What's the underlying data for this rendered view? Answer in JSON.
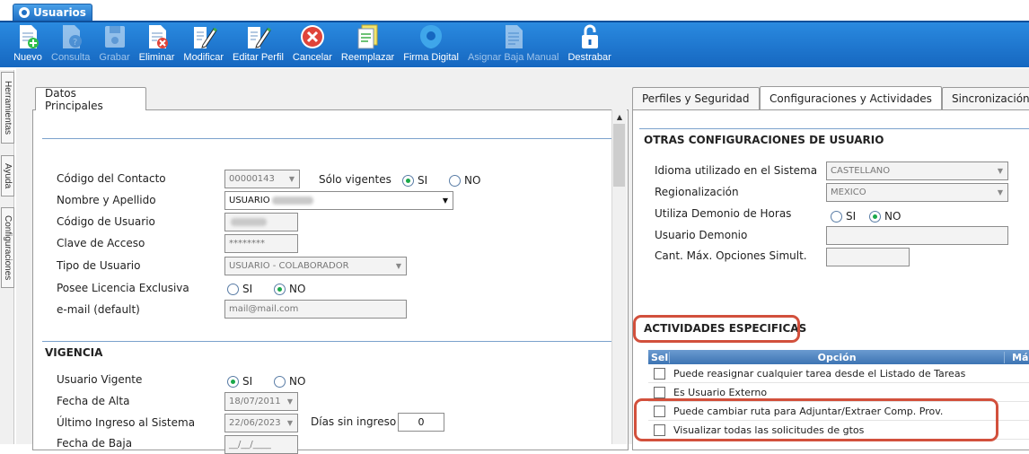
{
  "window_tab": {
    "title": "Usuarios"
  },
  "toolbar": [
    {
      "label": "Nuevo",
      "icon": "new-doc-icon",
      "enabled": true
    },
    {
      "label": "Consulta",
      "icon": "query-icon",
      "enabled": false
    },
    {
      "label": "Grabar",
      "icon": "save-icon",
      "enabled": false
    },
    {
      "label": "Eliminar",
      "icon": "delete-icon",
      "enabled": true
    },
    {
      "label": "Modificar",
      "icon": "edit-icon",
      "enabled": true
    },
    {
      "label": "Editar Perfil",
      "icon": "edit-profile-icon",
      "enabled": true
    },
    {
      "label": "Cancelar",
      "icon": "cancel-icon",
      "enabled": true
    },
    {
      "label": "Reemplazar",
      "icon": "replace-icon",
      "enabled": true
    },
    {
      "label": "Firma Digital",
      "icon": "digital-signature-icon",
      "enabled": true
    },
    {
      "label": "Asignar Baja Manual",
      "icon": "manual-removal-icon",
      "enabled": false
    },
    {
      "label": "Destrabar",
      "icon": "unlock-icon",
      "enabled": true
    }
  ],
  "side_tabs": [
    "Herramientas",
    "Ayuda",
    "Configuraciones"
  ],
  "left": {
    "tab": "Datos Principales",
    "codigo_contacto": {
      "label": "Código del Contacto",
      "value": "00000143"
    },
    "solo_vigentes": {
      "label": "Sólo vigentes",
      "si": "SI",
      "no": "NO"
    },
    "nombre": {
      "label": "Nombre y Apellido",
      "value": "USUARIO"
    },
    "codigo_usuario": {
      "label": "Código de Usuario"
    },
    "clave": {
      "label": "Clave de Acceso",
      "value": "********"
    },
    "tipo_usuario": {
      "label": "Tipo de Usuario",
      "value": "USUARIO - COLABORADOR"
    },
    "licencia": {
      "label": "Posee Licencia Exclusiva",
      "si": "SI",
      "no": "NO"
    },
    "email": {
      "label": "e-mail (default)",
      "value": "mail@mail.com"
    },
    "vigencia_title": "VIGENCIA",
    "usuario_vigente": {
      "label": "Usuario Vigente",
      "si": "SI",
      "no": "NO"
    },
    "fecha_alta": {
      "label": "Fecha de Alta",
      "value": "18/07/2011"
    },
    "ultimo_ingreso": {
      "label": "Último Ingreso al Sistema",
      "value": "22/06/2023"
    },
    "dias_sin_ingreso": {
      "label": "Días sin ingreso",
      "value": "0"
    },
    "fecha_baja": {
      "label": "Fecha de Baja",
      "value": "__/__/____"
    }
  },
  "right": {
    "tabs": [
      "Perfiles y Seguridad",
      "Configuraciones y Actividades",
      "Sincronización"
    ],
    "otras_title": "OTRAS CONFIGURACIONES DE USUARIO",
    "idioma": {
      "label": "Idioma utilizado en el Sistema",
      "value": "CASTELLANO"
    },
    "regionalizacion": {
      "label": "Regionalización",
      "value": "MEXICO"
    },
    "demonio_horas": {
      "label": "Utiliza Demonio de Horas",
      "si": "SI",
      "no": "NO"
    },
    "usuario_demonio": {
      "label": "Usuario Demonio"
    },
    "cant_max": {
      "label": "Cant. Máx. Opciones Simult."
    },
    "actividades_title": "ACTIVIDADES ESPECIFICAS",
    "table": {
      "headers": [
        "Sel",
        "Opción",
        "Más"
      ],
      "rows": [
        "Puede reasignar cualquier tarea desde el Listado de Tareas",
        "Es Usuario Externo",
        "Puede cambiar ruta para Adjuntar/Extraer Comp. Prov.",
        "Visualizar todas las solicitudes de gtos"
      ]
    }
  },
  "colors": {
    "toolbar": "#1f78d1",
    "highlight": "#d2503c",
    "table_header": "#4f83bf"
  }
}
